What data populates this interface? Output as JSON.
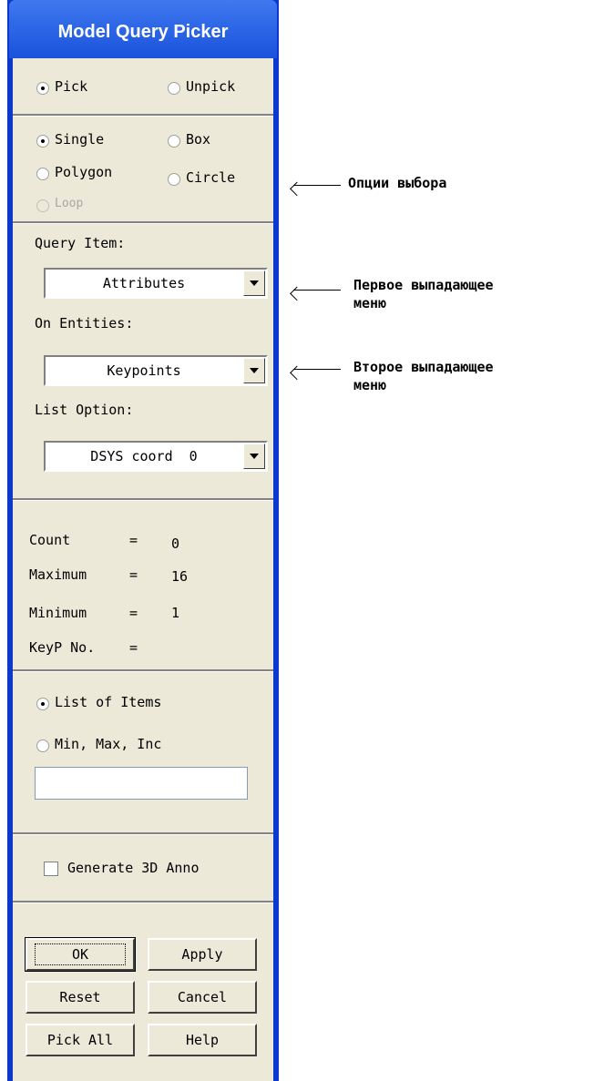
{
  "window": {
    "title": "Model Query Picker"
  },
  "pick_mode": {
    "pick": "Pick",
    "unpick": "Unpick",
    "selected": "pick"
  },
  "selection": {
    "single": "Single",
    "box": "Box",
    "polygon": "Polygon",
    "circle": "Circle",
    "loop": "Loop",
    "selected": "single"
  },
  "query": {
    "query_item_label": "Query Item:",
    "query_item_value": "Attributes",
    "on_entities_label": "On Entities:",
    "on_entities_value": "Keypoints",
    "list_option_label": "List Option:",
    "list_option_value": "DSYS coord  0"
  },
  "stats": {
    "count_label": "Count",
    "count_value": "0",
    "maximum_label": "Maximum",
    "maximum_value": "16",
    "minimum_label": "Minimum",
    "minimum_value": "1",
    "keyp_label": "KeyP No.",
    "keyp_value": "",
    "eq": "="
  },
  "list_mode": {
    "list_of_items": "List of Items",
    "min_max_inc": "Min, Max, Inc",
    "selected": "list_of_items",
    "input_value": ""
  },
  "generate_3d": {
    "label": "Generate 3D Anno",
    "checked": false
  },
  "buttons": {
    "ok": "OK",
    "apply": "Apply",
    "reset": "Reset",
    "cancel": "Cancel",
    "pick_all": "Pick All",
    "help": "Help"
  },
  "annotations": {
    "selection_options": "Опции выбора",
    "first_dropdown_line1": "Первое выпадающее",
    "first_dropdown_line2": "меню",
    "second_dropdown_line1": "Второе выпадающее",
    "second_dropdown_line2": "меню"
  }
}
